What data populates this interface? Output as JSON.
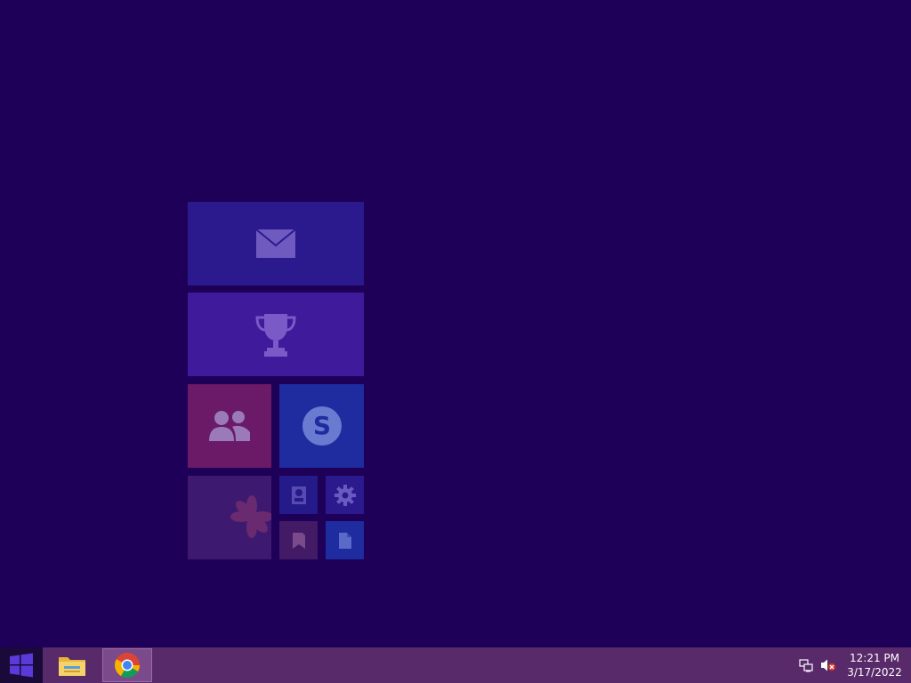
{
  "colors": {
    "desktop_background": "#1e0058",
    "taskbar_background": "#582a6a",
    "start_button_background": "#1a0a3a",
    "windows_logo": "#5a3ad8"
  },
  "start_tiles": [
    {
      "id": "mail",
      "icon": "mail-icon",
      "label": "",
      "color": "#2a1a8e"
    },
    {
      "id": "trophy",
      "icon": "trophy-icon",
      "label": "",
      "color": "#3f1a9a"
    },
    {
      "id": "people",
      "icon": "people-icon",
      "label": "",
      "color": "#6a1a66"
    },
    {
      "id": "skype",
      "icon": "skype-icon",
      "label": "",
      "color": "#1e2ca0"
    },
    {
      "id": "photos",
      "icon": "flower-icon",
      "label": "",
      "color": "#3d1a70"
    },
    {
      "id": "small-1",
      "icon": "contact-card-icon",
      "label": "",
      "color": "#241a8a"
    },
    {
      "id": "small-2",
      "icon": "gear-icon",
      "label": "",
      "color": "#2a1a8e"
    },
    {
      "id": "small-3",
      "icon": "bookmark-icon",
      "label": "",
      "color": "#431a66"
    },
    {
      "id": "small-4",
      "icon": "document-icon",
      "label": "",
      "color": "#1e2ca0"
    }
  ],
  "taskbar": {
    "apps": [
      {
        "name": "File Explorer",
        "icon": "folder-icon",
        "active": false
      },
      {
        "name": "Google Chrome",
        "icon": "chrome-icon",
        "active": true
      }
    ],
    "tray": {
      "network_icon": "network-icon",
      "volume_icon": "volume-muted-icon"
    },
    "clock": {
      "time": "12:21 PM",
      "date": "3/17/2022"
    }
  }
}
